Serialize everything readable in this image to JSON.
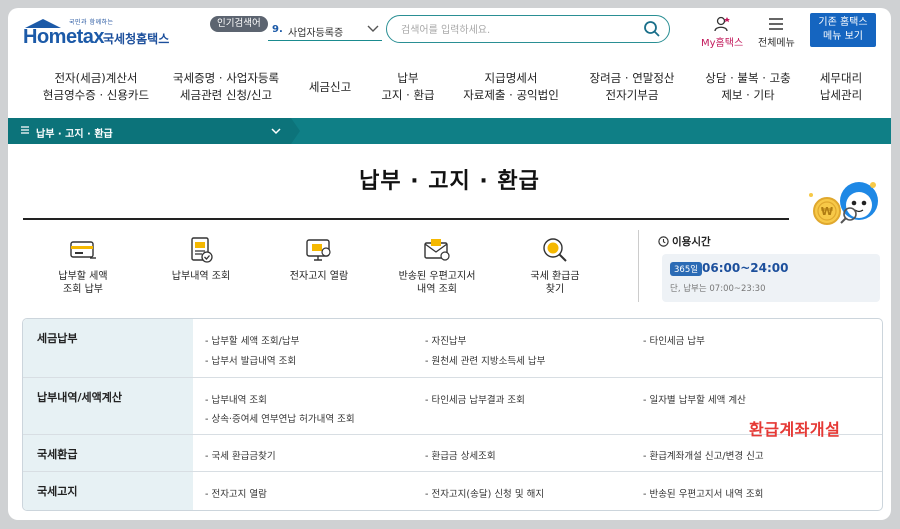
{
  "header": {
    "logo": {
      "tagline": "국민과 함께하는",
      "word": "Hometax",
      "name": "국세청홈택스"
    },
    "popular": {
      "label": "인기검색어",
      "rank": "9.",
      "keyword": "사업자등록증"
    },
    "search": {
      "placeholder": "검색어를 입력하세요."
    },
    "my_hometax": "My홈택스",
    "all_menu": "전체메뉴",
    "classic_line1": "기존 홈택스",
    "classic_line2": "메뉴 보기"
  },
  "gnb": [
    {
      "line1": "전자(세금)계산서",
      "line2": "현금영수증 · 신용카드"
    },
    {
      "line1": "국세증명 · 사업자등록",
      "line2": "세금관련 신청/신고"
    },
    {
      "line1": "세금신고",
      "line2": ""
    },
    {
      "line1": "납부",
      "line2": "고지 · 환급"
    },
    {
      "line1": "지급명세서",
      "line2": "자료제출 · 공익법인"
    },
    {
      "line1": "장려금 · 연말정산",
      "line2": "전자기부금"
    },
    {
      "line1": "상담 · 불복 · 고충",
      "line2": "제보 · 기타"
    },
    {
      "line1": "세무대리",
      "line2": "납세관리"
    }
  ],
  "breadcrumb": {
    "text": "납부 · 고지 · 환급"
  },
  "page_title": "납부 · 고지 · 환급",
  "quick": [
    {
      "line1": "납부할 세액",
      "line2": "조회 납부",
      "icon": "card-tax-icon"
    },
    {
      "line1": "납부내역 조회",
      "line2": "",
      "icon": "receipt-check-icon"
    },
    {
      "line1": "전자고지 열람",
      "line2": "",
      "icon": "monitor-bill-icon"
    },
    {
      "line1": "반송된 우편고지서",
      "line2": "내역 조회",
      "icon": "envelope-return-icon"
    },
    {
      "line1": "국세 환급금",
      "line2": "찾기",
      "icon": "coin-search-icon"
    }
  ],
  "hours": {
    "title": "이용시간",
    "badge": "365일",
    "time": "06:00~24:00",
    "note": "단, 납부는 07:00~23:30"
  },
  "table": [
    {
      "head": "세금납부",
      "cells": [
        "- 납부할 세액 조회/납부",
        "- 자진납부",
        "- 타인세금 납부",
        "- 납부서 발급내역 조회",
        "- 원천세 관련 지방소득세 납부"
      ]
    },
    {
      "head": "납부내역/세액계산",
      "cells": [
        "- 납부내역 조회",
        "- 타인세금 납부결과 조회",
        "- 일자별 납부할 세액 계산",
        "- 상속·증여세 연부연납 허가내역 조회"
      ]
    },
    {
      "head": "국세환급",
      "cells": [
        "- 국세 환급금찾기",
        "- 환급금 상세조회",
        "- 환급계좌개설 신고/변경 신고"
      ]
    },
    {
      "head": "국세고지",
      "cells": [
        "- 전자고지 열람",
        "- 전자고지(송달) 신청 및 해지",
        "- 반송된 우편고지서 내역 조회"
      ]
    }
  ],
  "overlay_text": "환급계좌개설",
  "colors": {
    "teal": "#0f7f86",
    "brand_blue": "#1c5aa8",
    "accent_red": "#e53935",
    "my_pink": "#c2185b"
  }
}
